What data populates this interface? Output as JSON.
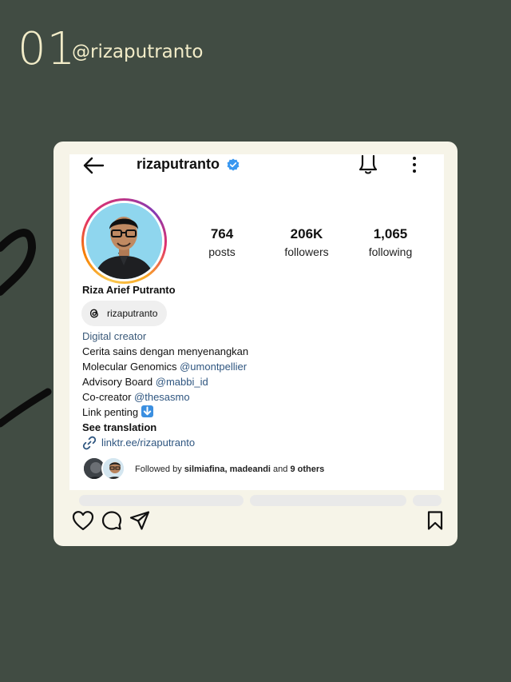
{
  "header": {
    "number": "01",
    "handle": "@rizaputranto"
  },
  "profile": {
    "username": "rizaputranto",
    "full_name": "Riza Arief Putranto",
    "threads_handle": "rizaputranto",
    "stats": {
      "posts_value": "764",
      "posts_label": "posts",
      "followers_value": "206K",
      "followers_label": "followers",
      "following_value": "1,065",
      "following_label": "following"
    },
    "bio": {
      "category": "Digital creator",
      "line1": "Cerita sains dengan menyenangkan",
      "line2_text": "Molecular Genomics ",
      "line2_mention": "@umontpellier",
      "line3_text": "Advisory Board ",
      "line3_mention": "@mabbi_id",
      "line4_text": "Co-creator ",
      "line4_mention": "@thesasmo",
      "line5_text": "Link penting",
      "see_translation": "See translation",
      "link": "linktr.ee/rizaputranto"
    },
    "followed_by": {
      "prefix": "Followed by ",
      "names": "silmiafina, madeandi",
      "middle": " and ",
      "others": "9 others"
    }
  },
  "icons": {
    "back": "back-arrow-icon",
    "verified": "verified-badge-icon",
    "bell": "bell-icon",
    "more": "more-vertical-icon",
    "threads": "threads-icon",
    "link": "link-icon",
    "heart": "heart-icon",
    "comment": "comment-icon",
    "share": "share-icon",
    "bookmark": "bookmark-icon"
  },
  "colors": {
    "background": "#414c43",
    "header_text": "#f2ecc8",
    "card": "#f6f4e8",
    "verified": "#3897f0",
    "mention": "#2f5680"
  }
}
